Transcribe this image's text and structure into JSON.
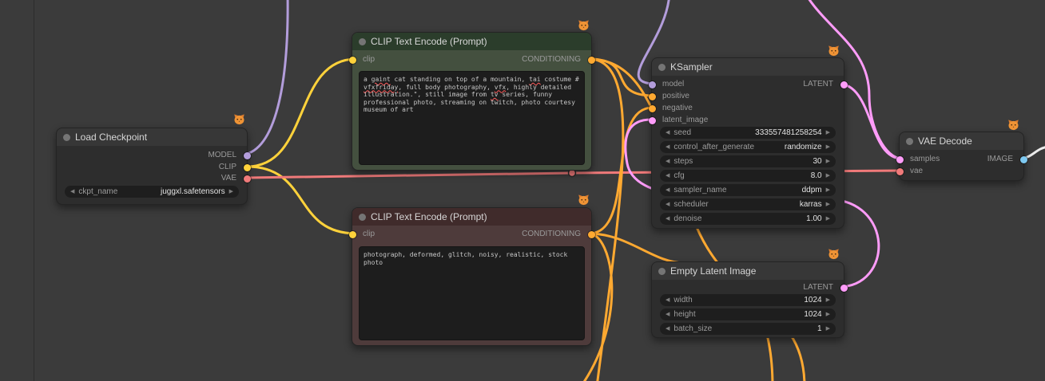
{
  "colors": {
    "model": "#b39ddb",
    "clip": "#ffd23b",
    "vae": "#f07a7a",
    "conditioning": "#ffa931",
    "latent": "#ff9cf9",
    "image": "#7ec9f1",
    "wire_white": "#ececec",
    "collapse_dot": "#757575"
  },
  "ui": {
    "arrow_left": "◀",
    "arrow_right": "▶"
  },
  "nodes": {
    "load_checkpoint": {
      "title": "Load Checkpoint",
      "outputs": [
        "MODEL",
        "CLIP",
        "VAE"
      ],
      "widget": {
        "label": "ckpt_name",
        "value": "juggxl.safetensors"
      }
    },
    "clip_positive": {
      "title": "CLIP Text Encode (Prompt)",
      "input_label": "clip",
      "output_label": "CONDITIONING",
      "prompt_segments": [
        {
          "text": "a "
        },
        {
          "text": "gaint",
          "misspelled": true
        },
        {
          "text": " cat standing on top of a mountain, "
        },
        {
          "text": "tai",
          "misspelled": true
        },
        {
          "text": " costume # "
        },
        {
          "text": "vfxfriday",
          "misspelled": true
        },
        {
          "text": ", full body photography, "
        },
        {
          "text": "vfx",
          "misspelled": true
        },
        {
          "text": ", highly detailed illustration.\", still image from "
        },
        {
          "text": "tv",
          "misspelled": true
        },
        {
          "text": " series, funny professional photo, streaming on twitch, photo courtesy museum of art"
        }
      ]
    },
    "clip_negative": {
      "title": "CLIP Text Encode (Prompt)",
      "input_label": "clip",
      "output_label": "CONDITIONING",
      "prompt": "photograph, deformed, glitch, noisy, realistic, stock photo"
    },
    "ksampler": {
      "title": "KSampler",
      "inputs": [
        "model",
        "positive",
        "negative",
        "latent_image"
      ],
      "output_label": "LATENT",
      "widgets": [
        {
          "label": "seed",
          "value": "333557481258254"
        },
        {
          "label": "control_after_generate",
          "value": "randomize"
        },
        {
          "label": "steps",
          "value": "30"
        },
        {
          "label": "cfg",
          "value": "8.0"
        },
        {
          "label": "sampler_name",
          "value": "ddpm"
        },
        {
          "label": "scheduler",
          "value": "karras"
        },
        {
          "label": "denoise",
          "value": "1.00"
        }
      ]
    },
    "empty_latent": {
      "title": "Empty Latent Image",
      "output_label": "LATENT",
      "widgets": [
        {
          "label": "width",
          "value": "1024"
        },
        {
          "label": "height",
          "value": "1024"
        },
        {
          "label": "batch_size",
          "value": "1"
        }
      ]
    },
    "vae_decode": {
      "title": "VAE Decode",
      "inputs": [
        "samples",
        "vae"
      ],
      "output_label": "IMAGE"
    }
  }
}
